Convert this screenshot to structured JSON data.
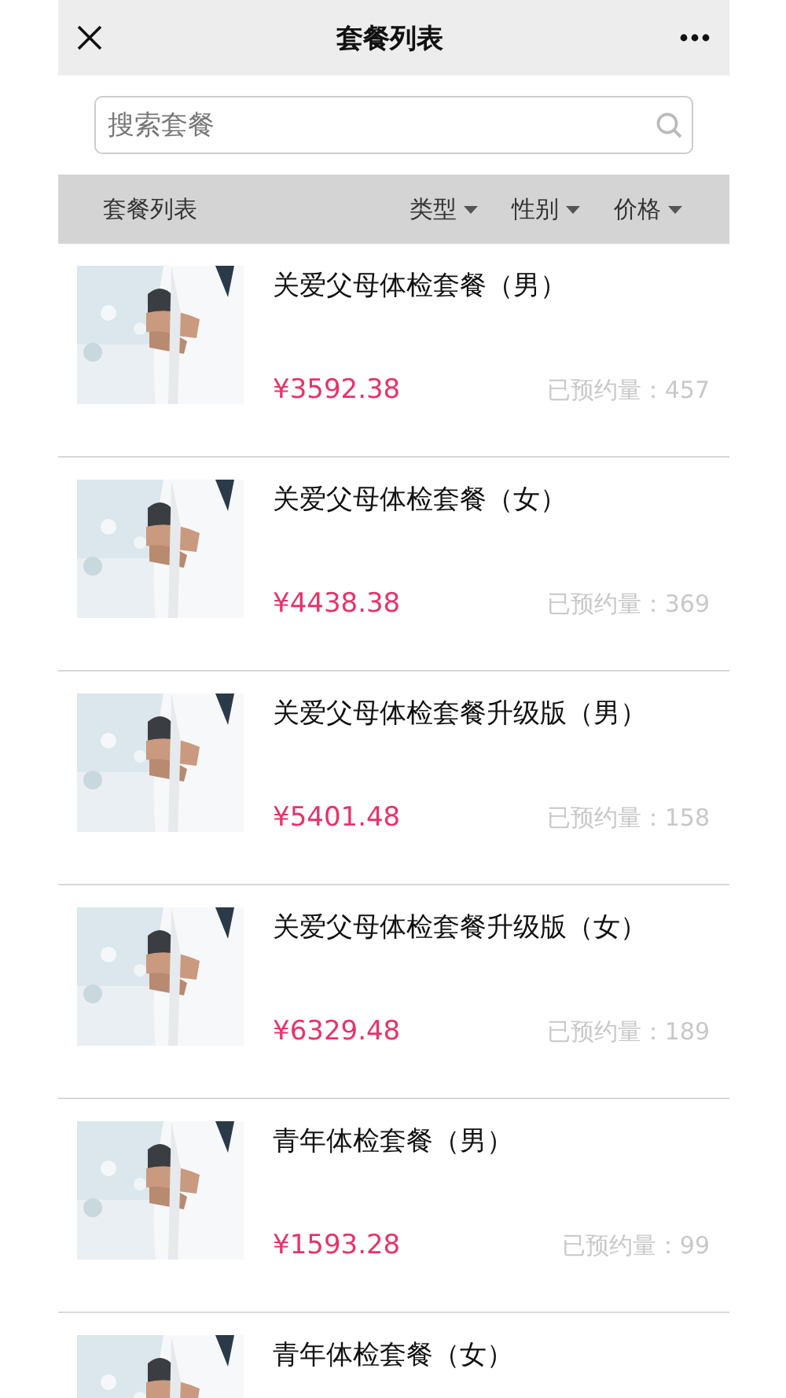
{
  "nav_bar": {
    "title": "套餐列表"
  },
  "search": {
    "placeholder": "搜索套餐"
  },
  "filter_bar": {
    "label": "套餐列表",
    "filters": [
      {
        "label": "类型"
      },
      {
        "label": "性别"
      },
      {
        "label": "价格"
      }
    ]
  },
  "packages": [
    {
      "kind": "picture",
      "name": "关爱父母体检套餐（男）",
      "price": "¥3592.38",
      "booked": "已预约量：457"
    },
    {
      "kind": "picture",
      "name": "关爱父母体检套餐（女）",
      "price": "¥4438.38",
      "booked": "已预约量：369"
    },
    {
      "kind": "picture",
      "name": "关爱父母体检套餐升级版（男）",
      "price": "¥5401.48",
      "booked": "已预约量：158"
    },
    {
      "kind": "picture",
      "name": "关爱父母体检套餐升级版（女）",
      "price": "¥6329.48",
      "booked": "已预约量：189"
    },
    {
      "kind": "picture",
      "name": "青年体检套餐（男）",
      "price": "¥1593.28",
      "booked": "已预约量：99"
    },
    {
      "kind": "picture",
      "name": "青年体检套餐（女）"
    }
  ]
}
